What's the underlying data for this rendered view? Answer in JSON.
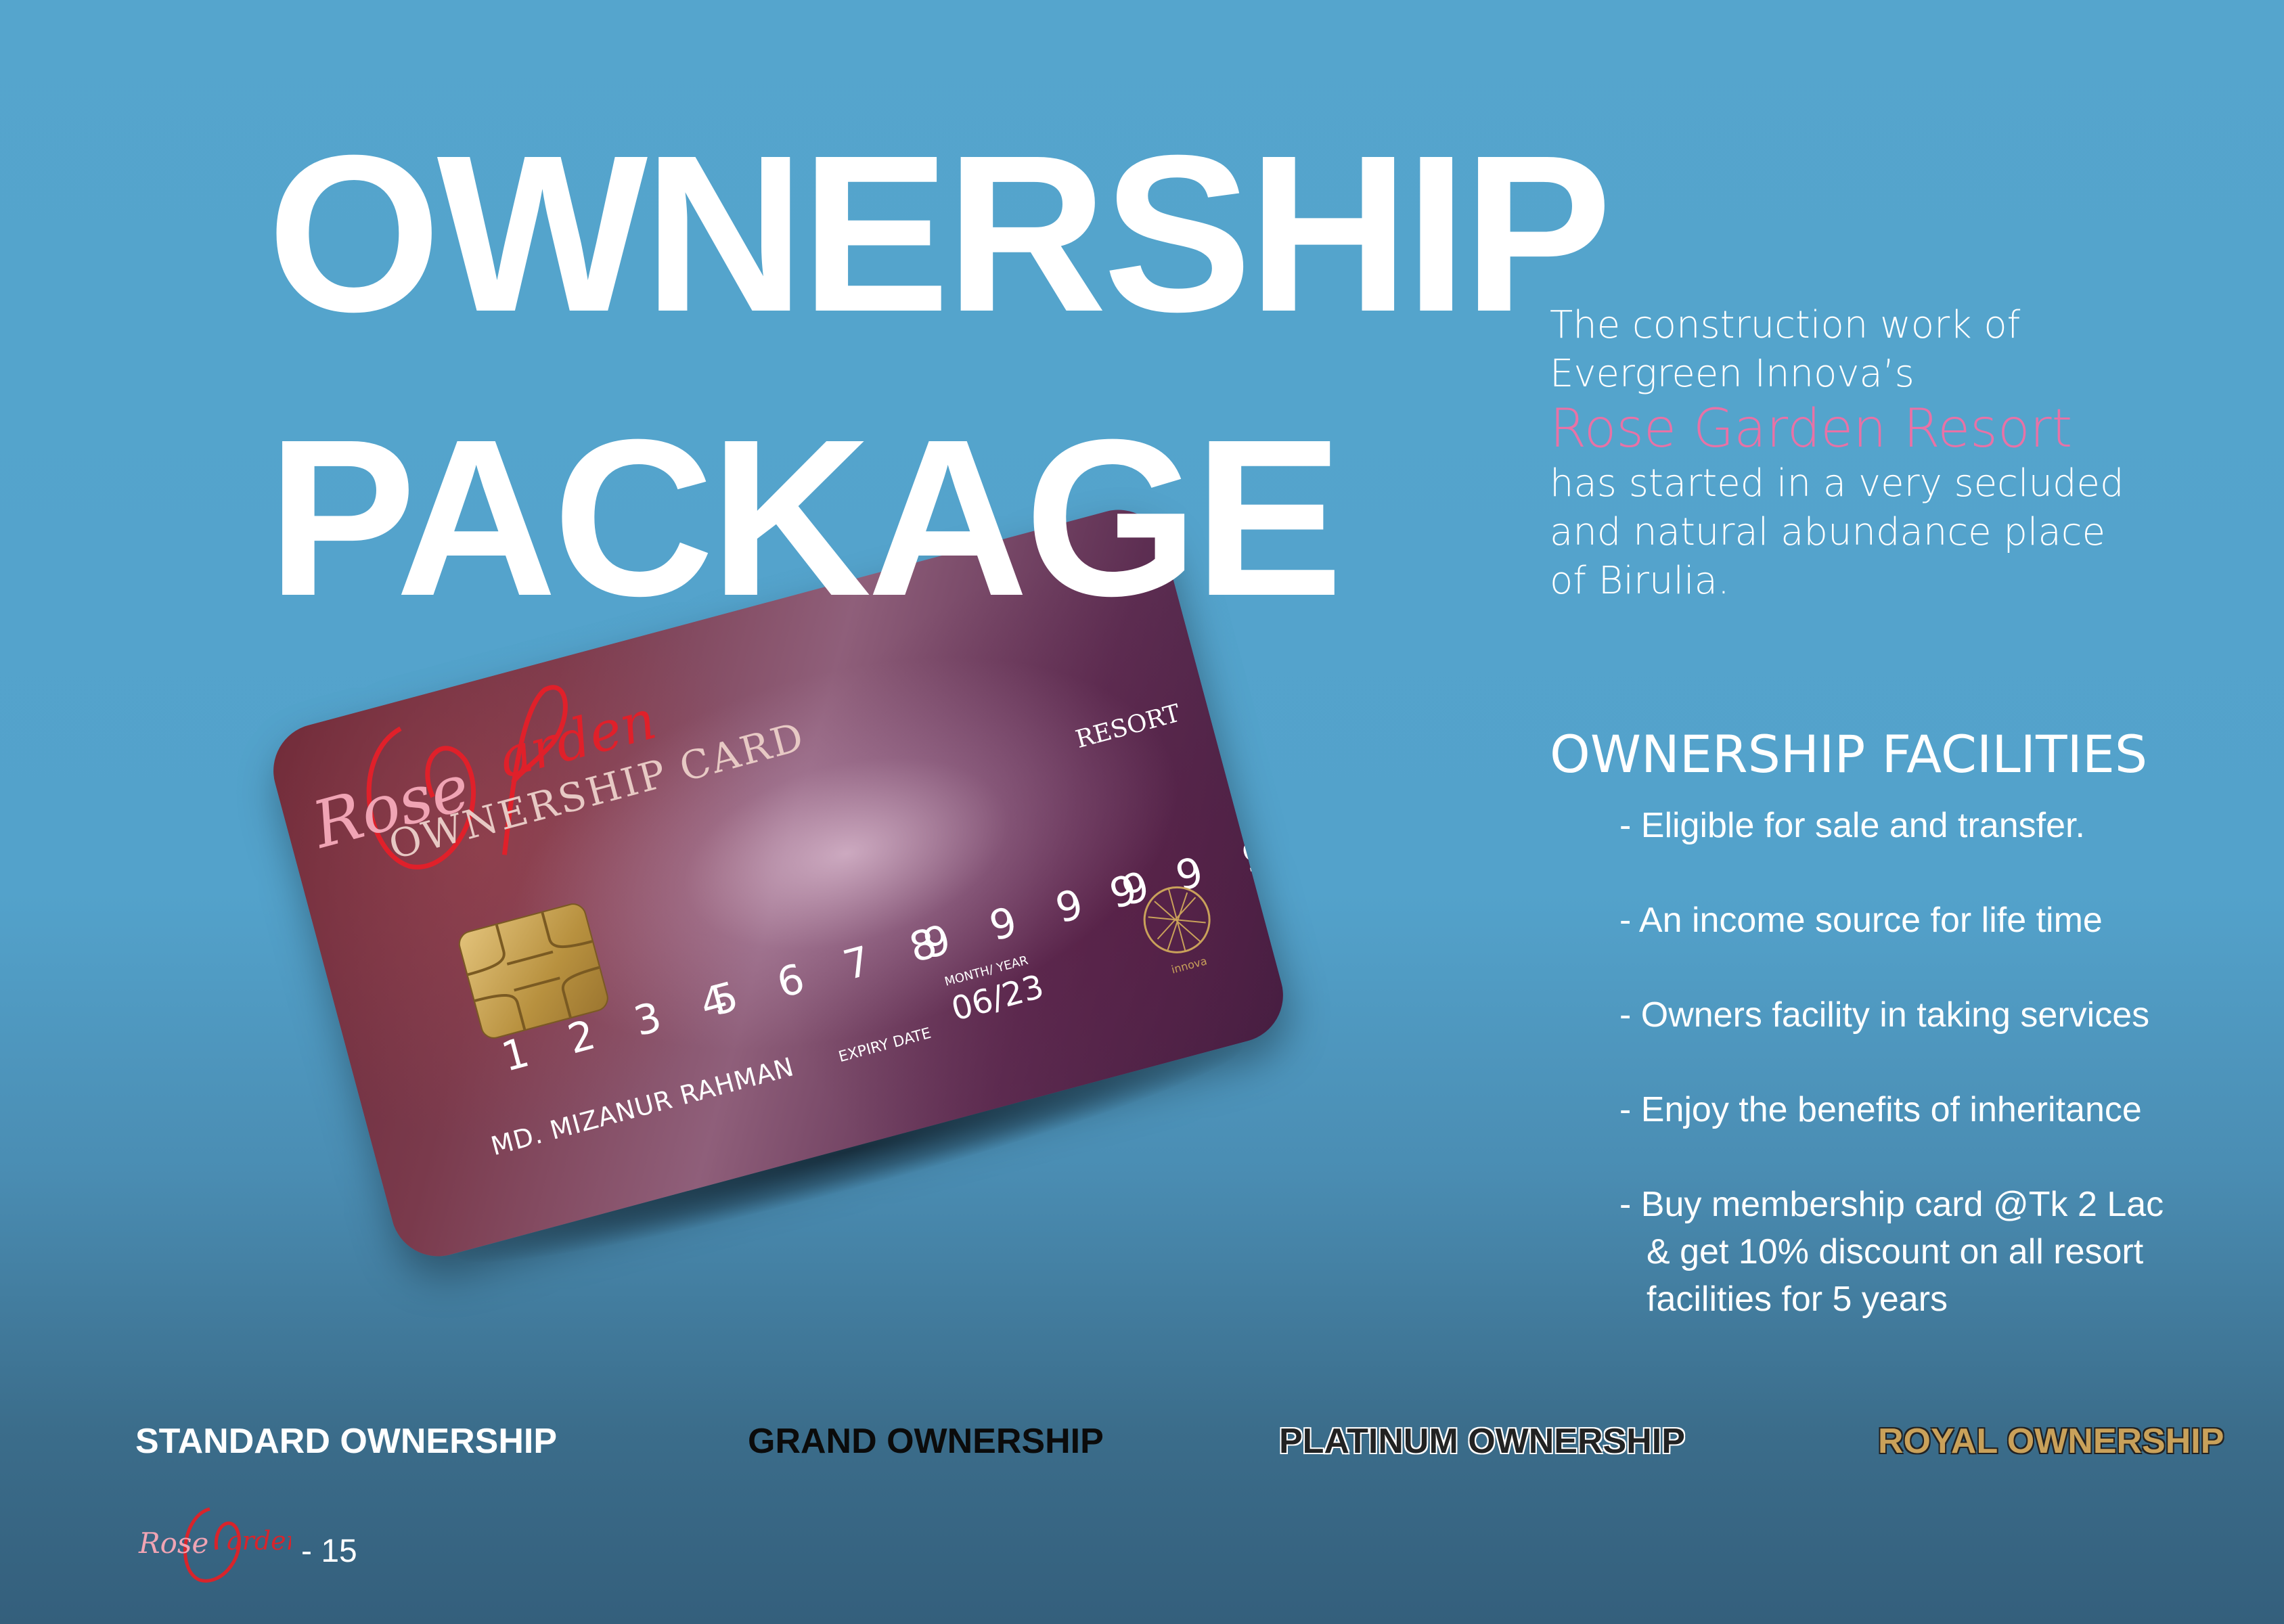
{
  "title": {
    "line1": "OWNERSHIP",
    "line2": "PACKAGE"
  },
  "card": {
    "label": "OWNERSHIP CARD",
    "logo_text": "Rose Garden",
    "resort": "RESORT",
    "numbers": [
      "1 2 3 4",
      "5 6 7 8",
      "9 9 9 9",
      "9 9 9 9"
    ],
    "holder_name": "MD. MIZANUR RAHMAN",
    "expiry_label": "EXPIRY DATE",
    "month_year_label": "MONTH/ YEAR",
    "expiry": "06/23",
    "emblem_text": "innova"
  },
  "intro": {
    "line1": "The construction work of",
    "line2": "Evergreen Innova’s",
    "highlight": "Rose Garden Resort",
    "line3": "has started in a very secluded",
    "line4": "and natural abundance place",
    "line5": "of Birulia."
  },
  "facilities": {
    "title": "OWNERSHIP FACILITIES",
    "items": [
      "- Eligible for sale and transfer.",
      "- An income source for life time",
      "- Owners facility in taking services",
      "- Enjoy the benefits of  inheritance",
      "- Buy membership card @Tk 2 Lac"
    ],
    "item4_cont1": "& get 10% discount on all resort",
    "item4_cont2": "facilities for 5 years"
  },
  "tiers": [
    "STANDARD OWNERSHIP",
    "GRAND OWNERSHIP",
    "PLATINUM OWNERSHIP",
    "ROYAL OWNERSHIP"
  ],
  "footer": {
    "logo_text": "Rose Garden",
    "page": "-  15"
  },
  "colors": {
    "background": "#55a5cd",
    "highlight": "#e872a6",
    "logo_red": "#d8242b",
    "gold": "#c9a15a"
  }
}
